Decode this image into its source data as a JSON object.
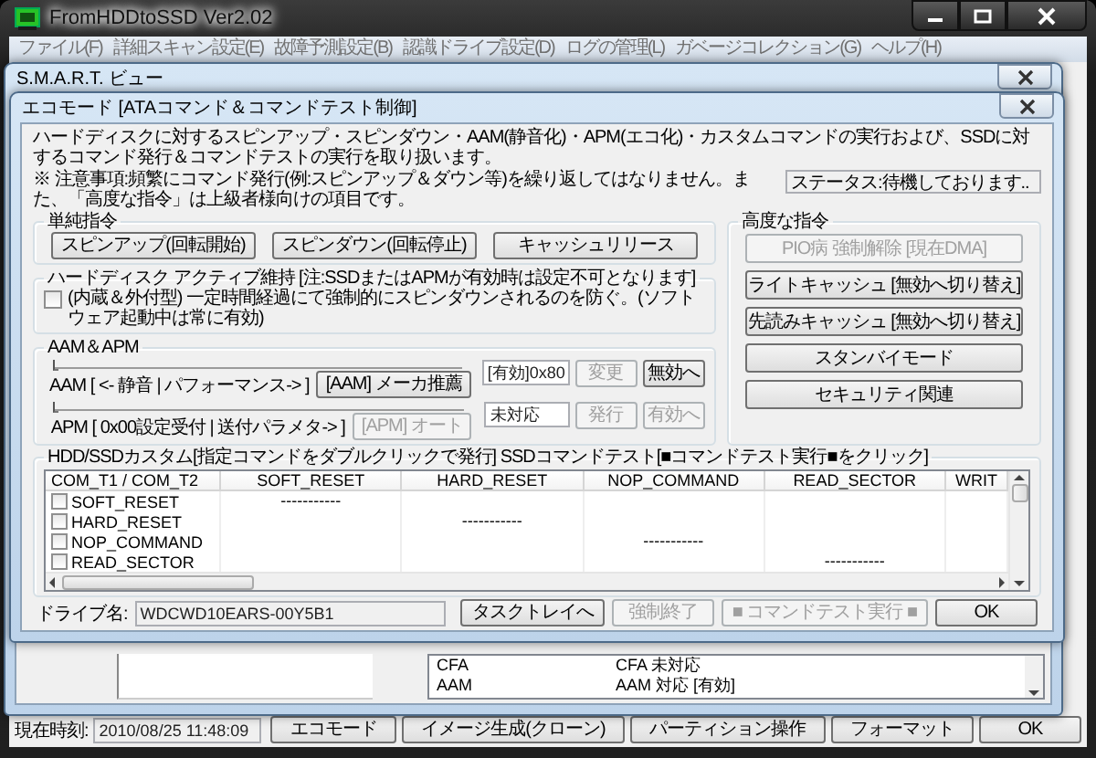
{
  "window": {
    "title": "FromHDDtoSSD Ver2.02"
  },
  "menu": [
    {
      "label": "ファイル(F)",
      "disabled": true
    },
    {
      "label": "詳細スキャン設定(E)",
      "disabled": true
    },
    {
      "label": "故障予測設定(B)",
      "disabled": true
    },
    {
      "label": "認識ドライブ設定(D)",
      "disabled": true
    },
    {
      "label": "ログの管理(L)",
      "disabled": true
    },
    {
      "label": "ガベージコレクション(G)",
      "disabled": true
    },
    {
      "label": "ヘルプ(H)",
      "disabled": true
    }
  ],
  "smart_window": {
    "title": "S.M.A.R.T. ビュー",
    "details": [
      {
        "item": "CFA",
        "value": "CFA 未対応"
      },
      {
        "item": "AAM",
        "value": "AAM 対応 [有効]"
      }
    ]
  },
  "dialog": {
    "title": "エコモード [ATAコマンド＆コマンドテスト制御]",
    "description": "ハードディスクに対するスピンアップ・スピンダウン・AAM(静音化)・APM(エコ化)・カスタムコマンドの実行および、SSDに対するコマンド発行＆コマンドテストの実行を取り扱います。",
    "notice": "※ 注意事項:頻繁にコマンド発行(例:スピンアップ＆ダウン等)を繰り返してはなりません。また、「高度な指令」は上級者様向けの項目です。",
    "status": "ステータス:待機しております..",
    "simple_commands": {
      "title": "単純指令",
      "buttons": [
        {
          "label": "スピンアップ(回転開始)",
          "disabled": false
        },
        {
          "label": "スピンダウン(回転停止)",
          "disabled": false
        },
        {
          "label": "キャッシュリリース",
          "disabled": false
        }
      ]
    },
    "keep_active": {
      "title": "ハードディスク アクティブ維持 [注:SSDまたはAPMが有効時は設定不可となります]",
      "checkbox": {
        "label": "(内蔵＆外付型) 一定時間経過にて強制的にスピンダウンされるのを防ぐ。(ソフトウェア起動中は常に有効)",
        "checked": false
      }
    },
    "aam_apm": {
      "title": "AAM＆APM",
      "rows": [
        {
          "label": "AAM [ <- 静音 | パフォーマンス-> ]",
          "level": 0,
          "value": "[有効]0x80",
          "preset": {
            "label": "[AAM] メーカ推薦",
            "disabled": false
          },
          "buttons": [
            {
              "label": "変更",
              "disabled": true
            },
            {
              "label": "無効へ",
              "disabled": false
            }
          ]
        },
        {
          "label": "APM [ 0x00設定受付 | 送付パラメタ-> ]",
          "level": 0,
          "value": "未対応",
          "preset": {
            "label": "[APM] オート",
            "disabled": true
          },
          "buttons": [
            {
              "label": "発行",
              "disabled": true
            },
            {
              "label": "有効へ",
              "disabled": true
            }
          ]
        }
      ]
    },
    "advanced": {
      "title": "高度な指令",
      "buttons": [
        {
          "label": "PIO病 強制解除 [現在DMA]",
          "disabled": true
        },
        {
          "label": "ライトキャッシュ [無効へ切り替え]",
          "disabled": false
        },
        {
          "label": "先読みキャッシュ [無効へ切り替え]",
          "disabled": false
        },
        {
          "label": "スタンバイモード",
          "disabled": false
        },
        {
          "label": "セキュリティ関連",
          "disabled": false
        }
      ]
    },
    "custom": {
      "title": "HDD/SSDカスタム[指定コマンドをダブルクリックで発行] SSDコマンドテスト[■コマンドテスト実行■をクリック]",
      "table": {
        "columns": [
          "COM_T1 / COM_T2",
          "SOFT_RESET",
          "HARD_RESET",
          "NOP_COMMAND",
          "READ_SECTOR",
          "WRIT"
        ],
        "rows": [
          {
            "checked": false,
            "cells": [
              "SOFT_RESET",
              "-----------",
              null,
              null,
              null,
              null
            ]
          },
          {
            "checked": false,
            "cells": [
              "HARD_RESET",
              null,
              "-----------",
              null,
              null,
              null
            ]
          },
          {
            "checked": false,
            "cells": [
              "NOP_COMMAND",
              null,
              null,
              "-----------",
              null,
              null
            ]
          },
          {
            "checked": false,
            "cells": [
              "READ_SECTOR",
              null,
              null,
              null,
              "-----------",
              null
            ]
          }
        ]
      }
    },
    "drive_label": "ドライブ名:",
    "drive_name": "WDCWD10EARS-00Y5B1",
    "buttons": [
      {
        "label": "タスクトレイへ",
        "disabled": false
      },
      {
        "label": "強制終了",
        "disabled": true
      },
      {
        "label": "■ コマンドテスト実行 ■",
        "disabled": true
      },
      {
        "label": "OK",
        "disabled": false
      }
    ]
  },
  "status_bar": {
    "time_label": "現在時刻:",
    "time": "2010/08/25 11:48:09",
    "buttons": [
      "エコモード",
      "イメージ生成(クローン)",
      "パーティション操作",
      "フォーマット",
      "OK"
    ]
  }
}
